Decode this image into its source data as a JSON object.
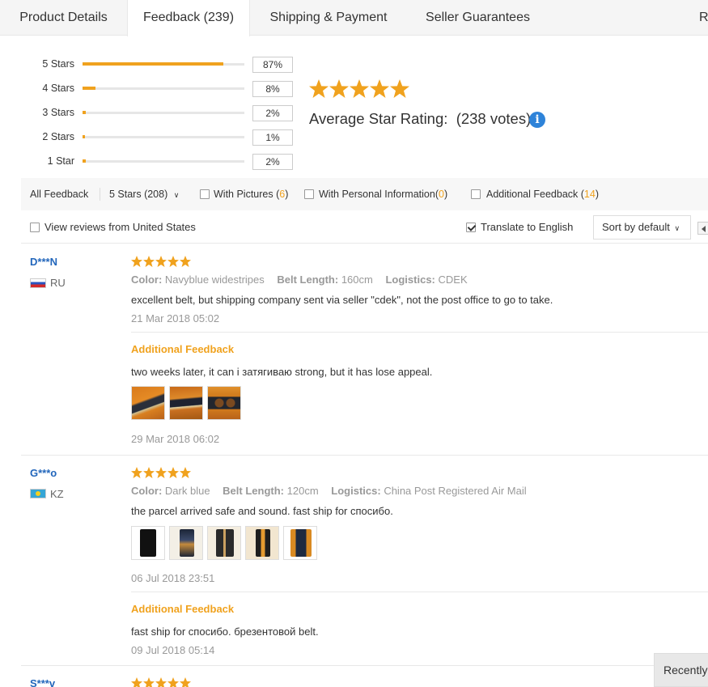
{
  "tabs": [
    {
      "label": "Product Details",
      "active": false
    },
    {
      "label": "Feedback (239)",
      "active": true
    },
    {
      "label": "Shipping & Payment",
      "active": false
    },
    {
      "label": "Seller Guarantees",
      "active": false
    },
    {
      "label": "Re",
      "active": false
    }
  ],
  "rating_breakdown": [
    {
      "label": "5 Stars",
      "percent_text": "87%",
      "percent": 87
    },
    {
      "label": "4 Stars",
      "percent_text": "8%",
      "percent": 8
    },
    {
      "label": "3 Stars",
      "percent_text": "2%",
      "percent": 2
    },
    {
      "label": "2 Stars",
      "percent_text": "1%",
      "percent": 1
    },
    {
      "label": "1 Star",
      "percent_text": "2%",
      "percent": 2
    }
  ],
  "average": {
    "stars": 5,
    "label": "Average Star Rating:",
    "votes": "(238 votes)",
    "info_icon": "i"
  },
  "filters": {
    "all_feedback": "All Feedback",
    "star_select": "5 Stars (208)",
    "with_pictures": {
      "label": "With Pictures",
      "count": "6"
    },
    "with_personal_info": {
      "label": "With Personal Information",
      "count": "0"
    },
    "additional_feedback": {
      "label": "Additional Feedback",
      "count": "14"
    },
    "view_us": "View reviews from United States",
    "translate": "Translate to English",
    "translate_checked": true,
    "sort": "Sort by default"
  },
  "reviews": [
    {
      "user": "D***N",
      "country": "RU",
      "stars": 5,
      "attrs": [
        {
          "k": "Color:",
          "v": "Navyblue widestripes"
        },
        {
          "k": "Belt Length:",
          "v": "160cm"
        },
        {
          "k": "Logistics:",
          "v": "CDEK"
        }
      ],
      "text": "excellent belt, but shipping company sent via seller \"cdek\", not the post office to go to take.",
      "date": "21 Mar 2018 05:02",
      "additional": {
        "label": "Additional Feedback",
        "text": "two weeks later, it can i затягиваю strong, but it has lose appeal.",
        "date": "29 Mar 2018 06:02"
      }
    },
    {
      "user": "G***o",
      "country": "KZ",
      "stars": 5,
      "attrs": [
        {
          "k": "Color:",
          "v": "Dark blue"
        },
        {
          "k": "Belt Length:",
          "v": "120cm"
        },
        {
          "k": "Logistics:",
          "v": "China Post Registered Air Mail"
        }
      ],
      "text": "the parcel arrived safe and sound. fast ship for спосибо.",
      "date": "06 Jul 2018 23:51",
      "additional": {
        "label": "Additional Feedback",
        "text": "fast ship for спосибо. брезентовой belt.",
        "date": "09 Jul 2018 05:14"
      }
    },
    {
      "user": "S***v",
      "stars": 5
    }
  ],
  "recently": "Recently",
  "colors": {
    "accent": "#f0a21e",
    "link": "#2266bb",
    "info": "#2e83d9"
  }
}
